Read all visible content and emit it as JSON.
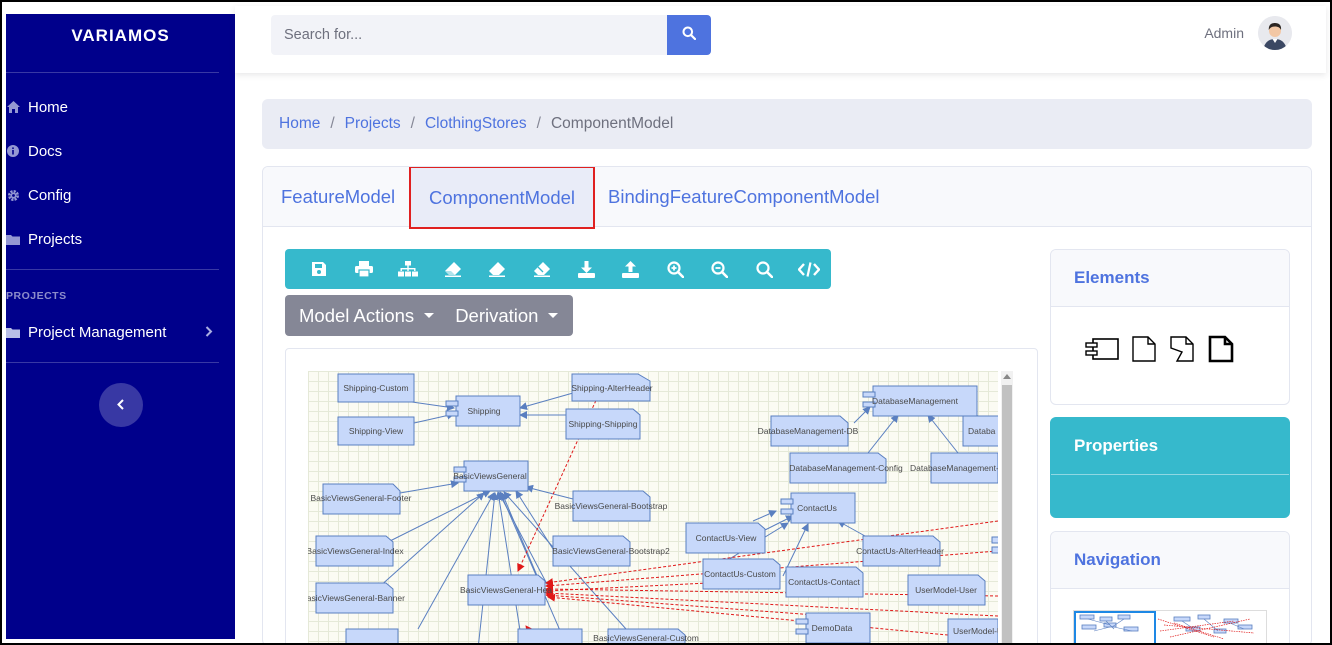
{
  "sidebar": {
    "brand": "VARIAMOS",
    "items": [
      {
        "label": "Home",
        "icon": "home-icon"
      },
      {
        "label": "Docs",
        "icon": "info-icon"
      },
      {
        "label": "Config",
        "icon": "gear-icon"
      },
      {
        "label": "Projects",
        "icon": "folder-icon"
      }
    ],
    "section_title": "PROJECTS",
    "project_management": {
      "label": "Project Management",
      "icon": "folder-icon"
    },
    "toggle_icon": "chevron-left-icon"
  },
  "topbar": {
    "search_placeholder": "Search for...",
    "search_icon": "search-icon",
    "user_name": "Admin"
  },
  "breadcrumb": {
    "items": [
      "Home",
      "Projects",
      "ClothingStores"
    ],
    "current": "ComponentModel",
    "separator": "/"
  },
  "tabs": [
    {
      "label": "FeatureModel",
      "active": false
    },
    {
      "label": "ComponentModel",
      "active": true
    },
    {
      "label": "BindingFeatureComponentModel",
      "active": false
    }
  ],
  "toolbar": {
    "buttons": [
      "save-icon",
      "print-icon",
      "sitemap-icon",
      "eraser-icon",
      "eraser-icon",
      "eraser-icon",
      "download-icon",
      "upload-icon",
      "zoom-in-icon",
      "zoom-out-icon",
      "search-icon",
      "code-icon"
    ]
  },
  "actions": {
    "model_actions": "Model Actions",
    "derivation": "Derivation"
  },
  "diagram": {
    "nodes": {
      "shipping_custom": "Shipping-Custom",
      "shipping_alterheader": "Shipping-AlterHeader",
      "shipping": "Shipping",
      "shipping_view": "Shipping-View",
      "shipping_shipping": "Shipping-Shipping",
      "database_management": "DatabaseManagement",
      "database_management_db": "DatabaseManagement-DB",
      "databa": "Databa",
      "database_management_config": "DatabaseManagement-Config",
      "database_management_dash": "DatabaseManagement-",
      "basic_views_general": "BasicViewsGeneral",
      "basic_views_general_footer": "BasicViewsGeneral-Footer",
      "basic_views_general_bootstrap": "BasicViewsGeneral-Bootstrap",
      "contact_us": "ContactUs",
      "contact_us_view": "ContactUs-View",
      "basic_views_general_index": "BasicViewsGeneral-Index",
      "basic_views_general_bootstrap2": "BasicViewsGeneral-Bootstrap2",
      "contact_us_alterheader": "ContactUs-AlterHeader",
      "contact_us_custom": "ContactUs-Custom",
      "contact_us_contact": "ContactUs-Contact",
      "basic_views_general_header": "BasicViewsGeneral-Hea",
      "user_model_user": "UserModel-User",
      "basic_views_general_banner": "BasicViewsGeneral-Banner",
      "demo_data": "DemoData",
      "basic_views_general_custom": "BasicViewsGeneral-Custom",
      "user_model_dash": "UserModel-U"
    }
  },
  "panels": {
    "elements": {
      "title": "Elements",
      "items": [
        "component-icon",
        "file-icon",
        "file-split-icon",
        "file-bold-icon"
      ]
    },
    "properties": {
      "title": "Properties"
    },
    "navigation": {
      "title": "Navigation"
    }
  },
  "colors": {
    "sidebar": "#00008b",
    "primary": "#4e73df",
    "toolbar": "#36b9cc",
    "actions": "#858796",
    "node_fill": "#c7d8fa",
    "node_stroke": "#5a7fc0",
    "dashed_arrow": "#e01818"
  }
}
